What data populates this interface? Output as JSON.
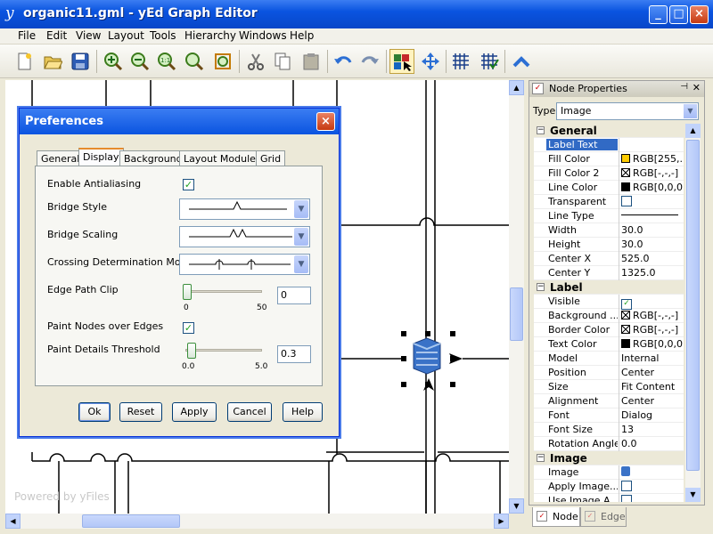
{
  "window": {
    "title": "organic11.gml - yEd Graph Editor",
    "app_icon": "y"
  },
  "menus": [
    "File",
    "Edit",
    "View",
    "Layout",
    "Tools",
    "Hierarchy",
    "Windows",
    "Help"
  ],
  "toolbar": [
    "new-icon",
    "open-icon",
    "save-icon",
    "zoom-in-icon",
    "zoom-out-icon",
    "zoom-reset-icon",
    "zoom-area-icon",
    "fit-content-icon",
    "cut-icon",
    "copy-icon",
    "paste-icon",
    "undo-icon",
    "redo-icon",
    "select-mode-icon",
    "navigate-mode-icon",
    "grid-icon",
    "snap-grid-icon",
    "collapse-up-icon"
  ],
  "canvas": {
    "watermark": "Powered by yFiles"
  },
  "dialog": {
    "title": "Preferences",
    "tabs": [
      "General",
      "Display",
      "Background",
      "Layout Modules",
      "Grid"
    ],
    "active_tab": "Display",
    "labels": {
      "antialias": "Enable Antialiasing",
      "bridge_style": "Bridge Style",
      "bridge_scaling": "Bridge Scaling",
      "crossing": "Crossing Determination Mode",
      "edge_clip": "Edge Path Clip",
      "paint_nodes": "Paint Nodes over Edges",
      "details": "Paint Details Threshold"
    },
    "values": {
      "antialias": true,
      "paint_nodes": true,
      "edge_clip": "0",
      "edge_clip_min": "0",
      "edge_clip_max": "50",
      "details": "0.3",
      "details_min": "0.0",
      "details_max": "5.0"
    },
    "slider_levels": {
      "edge_clip": 0.0,
      "details": 0.06
    },
    "buttons": {
      "ok": "Ok",
      "reset": "Reset",
      "apply": "Apply",
      "cancel": "Cancel",
      "help": "Help"
    }
  },
  "properties": {
    "title": "Node Properties",
    "type_label": "Type",
    "type_value": "Image",
    "general": {
      "header": "General",
      "rows": [
        {
          "name": "Label Text",
          "value": ""
        },
        {
          "name": "Fill Color",
          "value": "RGB[255,..."
        },
        {
          "name": "Fill Color 2",
          "value": "RGB[-,-,-]"
        },
        {
          "name": "Line Color",
          "value": "RGB[0,0,0]"
        },
        {
          "name": "Transparent",
          "value": ""
        },
        {
          "name": "Line Type",
          "value": ""
        },
        {
          "name": "Width",
          "value": "30.0"
        },
        {
          "name": "Height",
          "value": "30.0"
        },
        {
          "name": "Center X",
          "value": "525.0"
        },
        {
          "name": "Center Y",
          "value": "1325.0"
        }
      ]
    },
    "label": {
      "header": "Label",
      "rows": [
        {
          "name": "Visible",
          "value": ""
        },
        {
          "name": "Background ...",
          "value": "RGB[-,-,-]"
        },
        {
          "name": "Border Color",
          "value": "RGB[-,-,-]"
        },
        {
          "name": "Text Color",
          "value": "RGB[0,0,0]"
        },
        {
          "name": "Model",
          "value": "Internal"
        },
        {
          "name": "Position",
          "value": "Center"
        },
        {
          "name": "Size",
          "value": "Fit Content"
        },
        {
          "name": "Alignment",
          "value": "Center"
        },
        {
          "name": "Font",
          "value": "Dialog"
        },
        {
          "name": "Font Size",
          "value": "13"
        },
        {
          "name": "Rotation Angle",
          "value": "0.0"
        }
      ]
    },
    "image": {
      "header": "Image",
      "rows": [
        {
          "name": "Image",
          "value": ""
        },
        {
          "name": "Apply Image...",
          "value": ""
        },
        {
          "name": "Use Image A...",
          "value": ""
        }
      ]
    },
    "colors": {
      "fill": "#ffcc00",
      "line": "#000000",
      "text": "#000000",
      "selection": "#316ac5"
    }
  },
  "bottom_tabs": [
    "Node",
    "Edge"
  ]
}
